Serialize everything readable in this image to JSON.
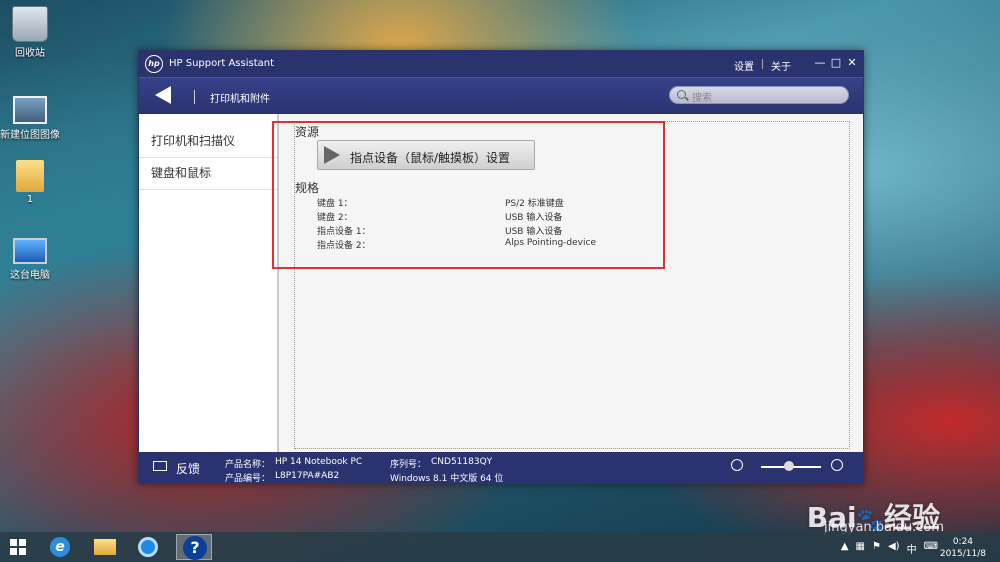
{
  "desktop": {
    "icons": [
      {
        "label": "回收站",
        "icon": "recycle-bin-icon"
      },
      {
        "label": "新建位图图像",
        "icon": "bitmap-image-icon"
      },
      {
        "label": "1",
        "icon": "folder-icon"
      },
      {
        "label": "这台电脑",
        "icon": "this-pc-icon"
      }
    ]
  },
  "window": {
    "app_title": "HP Support Assistant",
    "logo_text": "hp",
    "title_links": [
      "设置",
      "关于"
    ],
    "controls": [
      "—",
      "□",
      "✕"
    ],
    "nav_title": "打印机和附件",
    "search_placeholder": "搜索"
  },
  "sidebar": {
    "items": [
      {
        "label": "打印机和扫描仪",
        "active": false
      },
      {
        "label": "键盘和鼠标",
        "active": true
      }
    ]
  },
  "content": {
    "resources_heading": "资源",
    "pointing_button_label": "指点设备（鼠标/触摸板）设置",
    "specs_heading": "规格",
    "specs": [
      {
        "key": "键盘 1：",
        "value": "PS/2 标准键盘"
      },
      {
        "key": "键盘 2：",
        "value": "USB 输入设备"
      },
      {
        "key": "指点设备 1：",
        "value": "USB 输入设备"
      },
      {
        "key": "指点设备 2：",
        "value": "Alps Pointing-device"
      }
    ]
  },
  "footer": {
    "feedback_label": "反馈",
    "product_name_label": "产品名称：",
    "product_name": "HP 14 Notebook PC",
    "product_number_label": "产品编号：",
    "product_number": "L8P17PA#AB2",
    "serial_label": "序列号：",
    "serial": "CND51183QY",
    "os": "Windows 8.1 中文版 64 位"
  },
  "taskbar": {
    "apps": [
      "ie-icon",
      "file-explorer-icon",
      "browser-icon",
      "help-icon"
    ],
    "active_app": "help-icon",
    "tray_lang": "中",
    "time": "0:24",
    "date": "2015/11/8"
  },
  "watermark": {
    "brand": "Bai",
    "suffix": "经验",
    "url": "jingyan.baidu.com"
  },
  "colors": {
    "titlebar": "#2b3270",
    "highlight": "#e03030"
  }
}
